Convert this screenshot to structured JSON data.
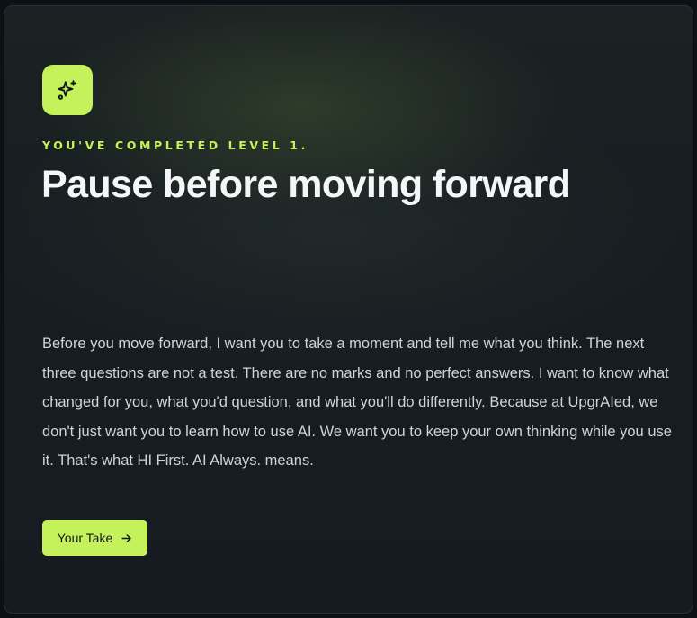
{
  "card": {
    "icon": "sparkles-icon",
    "eyebrow": "YOU'VE COMPLETED LEVEL 1.",
    "title": "Pause before moving forward",
    "body": "Before you move forward, I want you to take a moment and tell me what you think. The next three questions are not a test. There are no marks and no perfect answers. I want to know what changed for you, what you'd question, and what you'll do differently. Because at UpgrAIed, we don't just want you to learn how to use AI. We want you to keep your own thinking while you use it. That's what HI First. AI Always. means.",
    "cta_label": "Your Take",
    "cta_icon": "arrow-right-icon"
  },
  "colors": {
    "accent": "#c5f25a",
    "background": "#161b22",
    "title": "#f4f6f8",
    "body": "#cfd4da"
  }
}
